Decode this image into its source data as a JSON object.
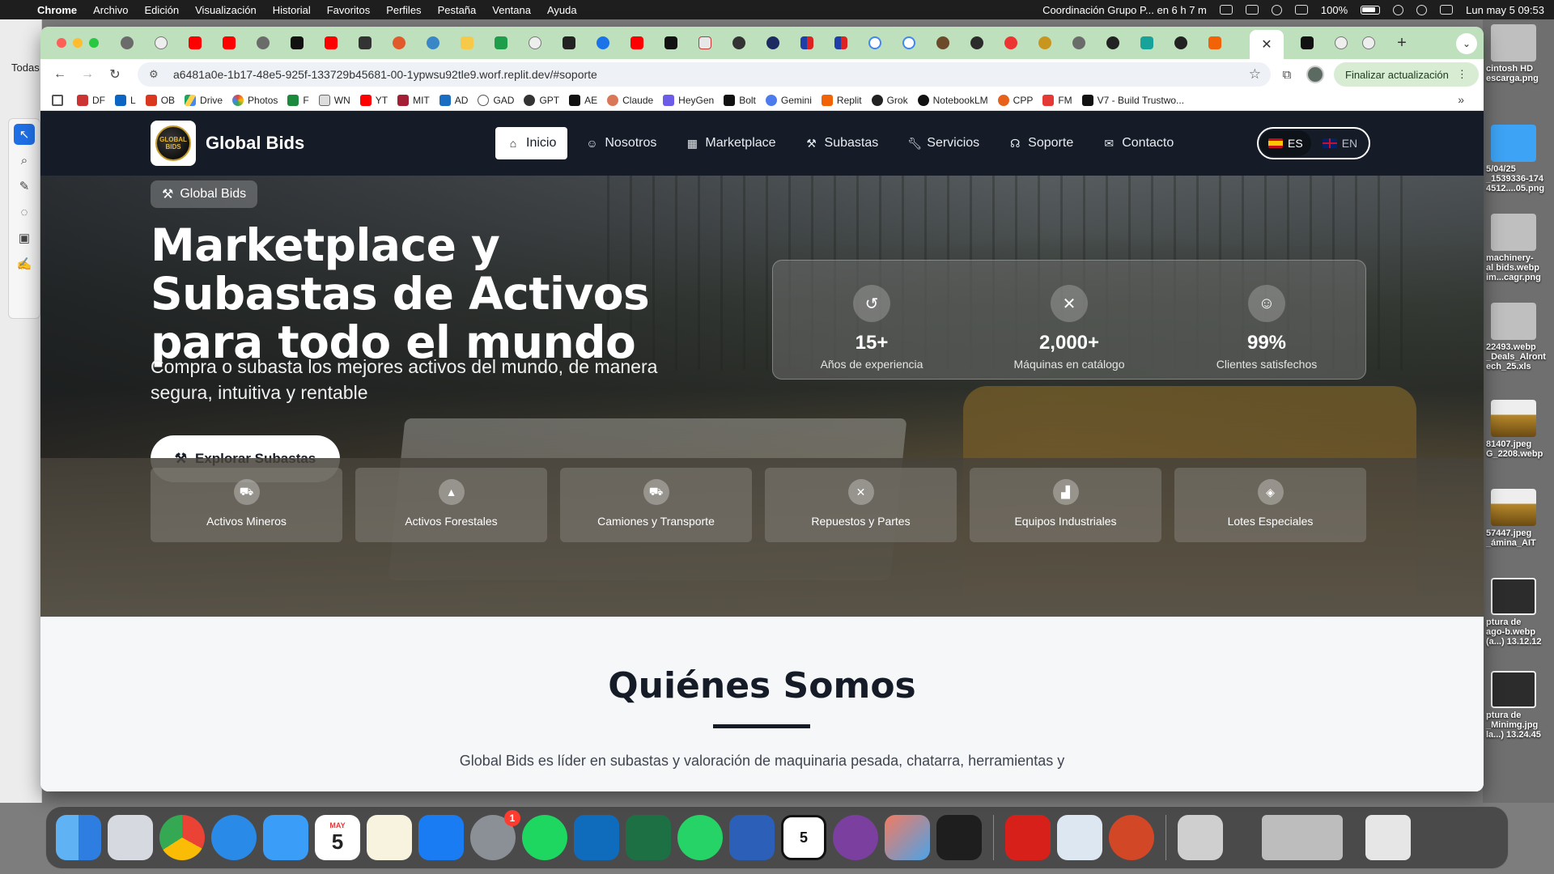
{
  "menubar": {
    "items": [
      "Chrome",
      "Archivo",
      "Edición",
      "Visualización",
      "Historial",
      "Favoritos",
      "Perfiles",
      "Pestaña",
      "Ventana",
      "Ayuda"
    ],
    "event": "Coordinación Grupo P... en 6 h 7 m",
    "battery": "100%",
    "datetime": "Lun may 5  09:53"
  },
  "sidebar": {
    "label": "Todas"
  },
  "browser": {
    "url": "a6481a0e-1b17-48e5-925f-133729b45681-00-1ypwsu92tle9.worf.replit.dev/#soporte",
    "update_button": "Finalizar actualización",
    "bookmarks": [
      "DF",
      "L",
      "OB",
      "Drive",
      "Photos",
      "F",
      "WN",
      "YT",
      "MIT",
      "AD",
      "GAD",
      "GPT",
      "AE",
      "Claude",
      "HeyGen",
      "Bolt",
      "Gemini",
      "Replit",
      "Grok",
      "NotebookLM",
      "CPP",
      "FM",
      "V7 - Build Trustwo..."
    ]
  },
  "site": {
    "brand": "Global Bids",
    "logo_text": "GLOBAL BIDS",
    "nav": [
      "Inicio",
      "Nosotros",
      "Marketplace",
      "Subastas",
      "Servicios",
      "Soporte",
      "Contacto"
    ],
    "lang": [
      "ES",
      "EN"
    ],
    "hero": {
      "badge": "Global Bids",
      "title": "Marketplace y Subastas de Activos para todo el mundo",
      "subtitle": "Compra o subasta los mejores activos del mundo, de manera segura, intuitiva y rentable",
      "cta": "Explorar Subastas"
    },
    "stats": [
      {
        "value": "15+",
        "label": "Años de experiencia",
        "icon": "history-icon"
      },
      {
        "value": "2,000+",
        "label": "Máquinas en catálogo",
        "icon": "tools-icon"
      },
      {
        "value": "99%",
        "label": "Clientes satisfechos",
        "icon": "smile-icon"
      }
    ],
    "categories": [
      "Activos Mineros",
      "Activos Forestales",
      "Camiones y Transporte",
      "Repuestos y Partes",
      "Equipos Industriales",
      "Lotes Especiales"
    ],
    "about": {
      "title": "Quiénes Somos",
      "text": "Global Bids es líder en subastas y valoración de maquinaria pesada, chatarra, herramientas y"
    }
  },
  "desktop": {
    "files": [
      "cintosh HD",
      "escarga.png",
      "5/04/25",
      "_1539336-174",
      "4512....05.png",
      "machinery-",
      "al bids.webp",
      "im...cagr.png",
      "22493.webp",
      "_Deals_Alront",
      "ech_25.xls",
      "81407.jpeg",
      "G_2208.webp",
      "57447.jpeg",
      "_ámina_AIT",
      "ptura de",
      "ago-b.webp",
      "(a...) 13.12.12",
      "ptura de",
      "_Minimg.jpg",
      "la...) 13.24.45"
    ]
  },
  "dock": {
    "calendar_month": "MAY",
    "calendar_day": "5",
    "settings_badge": "1",
    "apps": [
      "finder",
      "launchpad",
      "chrome",
      "safari",
      "mail",
      "calendar",
      "notes",
      "keynote",
      "system-settings",
      "spotify",
      "outlook",
      "excel",
      "whatsapp",
      "word",
      "calendar-5",
      "screen-recorder",
      "elements",
      "figma",
      "acrobat",
      "preview",
      "powerpoint"
    ]
  }
}
